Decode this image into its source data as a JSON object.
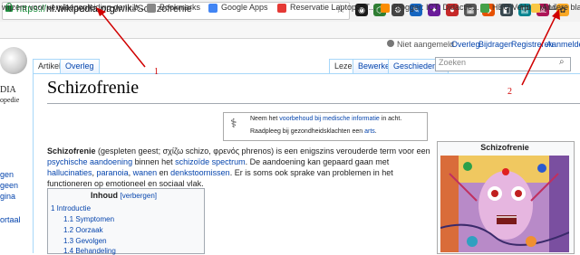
{
  "browser": {
    "url_protocol": "https://",
    "url_host": "nl.wikipedia.org",
    "url_path": "/wiki/Schizofrenie",
    "bookmarks": [
      "wijzers voor verpleegopleiding-genk.b...",
      "Bookmarks",
      "Google Apps",
      "Reservatie Laptops, T...",
      "Blogger: ICT: Didactie...",
      "HBO Verpleegkunde ...",
      "Home | LiZa",
      "Andere bladwi..."
    ]
  },
  "wiki": {
    "logo_name": "DIA",
    "logo_sub": "opedie",
    "personal": [
      "Niet aangemeld",
      "Overleg",
      "Bijdragen",
      "Registreren",
      "Aanmelden"
    ],
    "tabs_left": [
      "Artikel",
      "Overleg"
    ],
    "tabs_right": [
      "Lezen",
      "Bewerken",
      "Geschiedenis"
    ],
    "search_placeholder": "Zoeken",
    "sidebar_links": [
      "gen",
      "geen",
      "gina",
      "ortaal"
    ],
    "title": "Schizofrenie",
    "notice_line1_pre": "Neem het ",
    "notice_line1_link": "voorbehoud bij medische informatie",
    "notice_line1_post": " in acht.",
    "notice_line2_pre": "Raadpleeg bij gezondheidsklachten een ",
    "notice_line2_link": "arts",
    "notice_line2_post": ".",
    "para": {
      "term": "Schizofrenie",
      "t1": " (gespleten geest; σχίζω schizo, φρενός phrenos) is een enigszins verouderde term voor een ",
      "link1": "psychische aandoening",
      "t2": " binnen het ",
      "link2": "schizoïde spectrum",
      "t3": ". De aandoening kan gepaard gaan met ",
      "link3": "hallucinaties",
      "t4": ", ",
      "link4": "paranoia",
      "t5": ", ",
      "link5": "wanen",
      "t6": " en ",
      "link6": "denkstoornissen",
      "t7": ". Er is soms ook sprake van problemen in het functioneren op emotioneel en sociaal vlak."
    },
    "toc": {
      "title": "Inhoud",
      "toggle": "[verbergen]",
      "items": [
        "1 Introductie",
        "1.1 Symptomen",
        "1.2 Oorzaak",
        "1.3 Gevolgen",
        "1.4 Behandeling"
      ]
    },
    "infobox_title": "Schizofrenie"
  },
  "annotations": {
    "label1": "1",
    "label2": "2",
    "color": "#d00000"
  }
}
